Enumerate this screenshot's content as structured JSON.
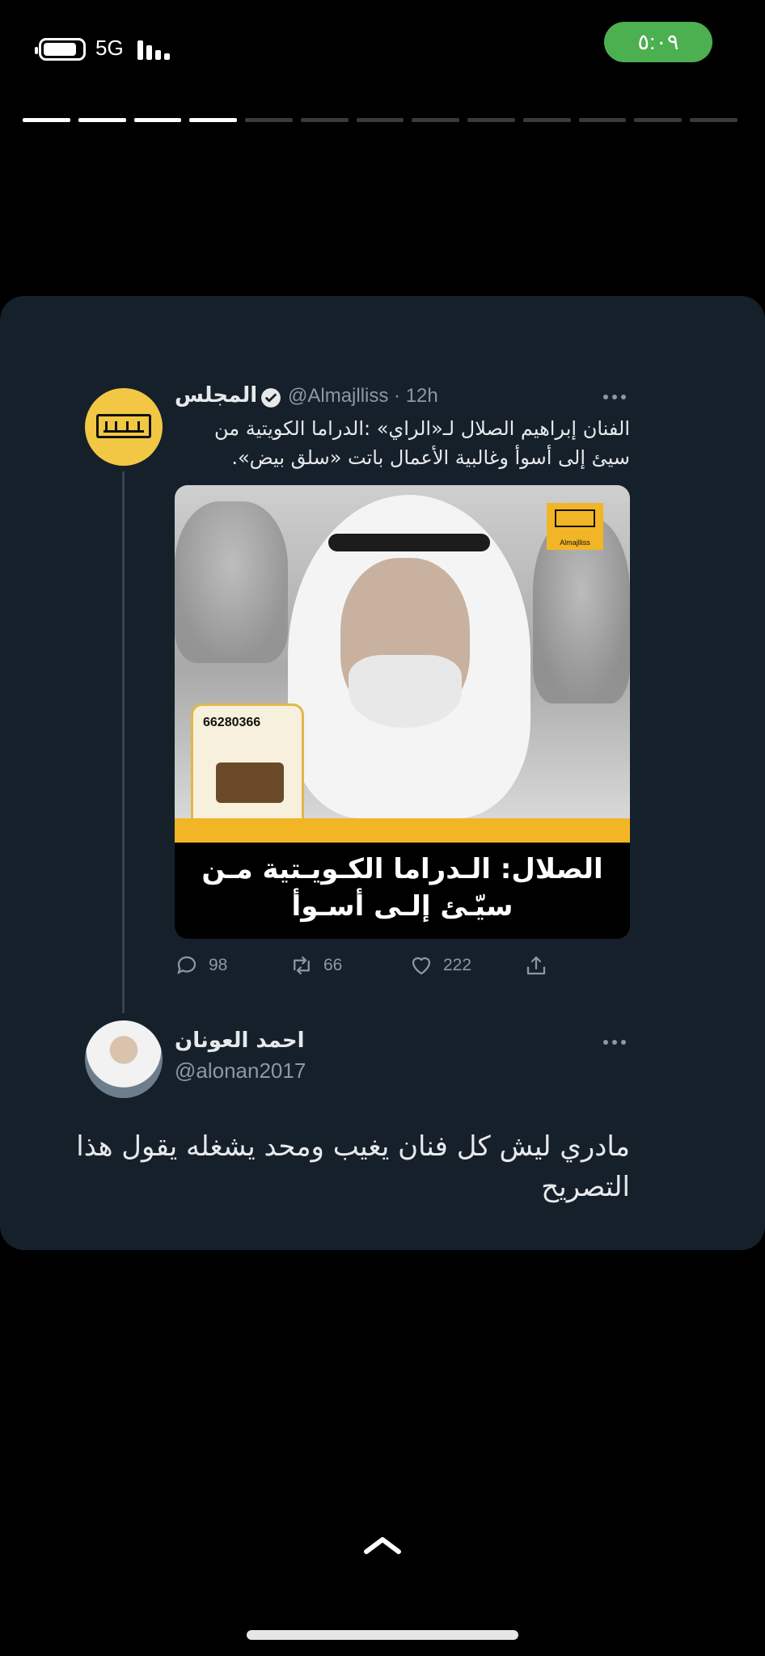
{
  "status_bar": {
    "network": "5G",
    "clock": "٥:٠٩"
  },
  "story_progress": {
    "segments_total": 13,
    "segments_done": 4
  },
  "quoted_tweet": {
    "author_name": "المجلس",
    "handle_time": "@Almajlliss · 12h",
    "text": "الفنان إبراهيم الصلال لـ«الراي» :الدراما الكويتية من سيئ إلى أسوأ وغالبية الأعمال باتت «سلق بيض».",
    "media": {
      "phone": "66280366",
      "brand_tag": "Almajlliss",
      "headline_line1": "الصلال: الـدراما الكـويـتية مـن",
      "headline_line2": "سيّـئ إلـى أسـوأ"
    },
    "actions": {
      "replies": "98",
      "retweets": "66",
      "likes": "222"
    }
  },
  "reply_tweet": {
    "author_name": "احمد العونان",
    "handle": "@alonan2017",
    "text": "مادري ليش كل فنان يغيب ومحد يشغله يقول هذا التصريح"
  },
  "colors": {
    "card_bg": "#15202b",
    "clock_pill": "#4caf50",
    "brand_yellow": "#f2c744",
    "muted_text": "#8b98a5"
  }
}
